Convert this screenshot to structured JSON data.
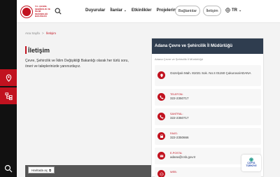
{
  "logo": {
    "name": "T.C. ÇEVRE, ŞEHİRCİLİK VE İKLİM DEĞİŞİKLİĞİ BAKANLIĞI"
  },
  "nav": {
    "items": [
      "Duyurular",
      "İlanlar",
      "Etkinlikler",
      "Projelerimiz"
    ]
  },
  "header_buttons": {
    "baglantilar": "Bağlantılar",
    "iletisim": "İletişim"
  },
  "lang": {
    "code": "TR"
  },
  "breadcrumb": {
    "home": "Ana Sayfa",
    "sep": ">",
    "current": "İletişim"
  },
  "page": {
    "title": "İletişim",
    "intro": "Çevre, Şehircilik ve İklim Değişikliği Bakanlığı olarak her türlü soru, öneri ve taleplerinizde yanınızdayız."
  },
  "map": {
    "chip": "Haritada aç"
  },
  "panel": {
    "title": "Adana Çevre ve Şehircilik İl Müdürlüğü",
    "subtitle": "Adana Çevre ve Şehircilik İl Müdürlüğü",
    "address": "Güzelyalı Mah. 81021 Sok. No:4 01150 Çukurova/ADANA",
    "phone_label": "TELEFON:",
    "phone": "322-2350717",
    "switchboard_label": "SANTRAL:",
    "switchboard": "322-2350717",
    "fax_label": "FAKS:",
    "fax": "322-2350666",
    "email_label": "E-POSTA:",
    "email": "adana@csb.gov.tr",
    "web_label": "WEB:"
  },
  "badge": {
    "line1": "COP31",
    "line2": "TÜRKİYE"
  },
  "colors": {
    "accent": "#c1121f",
    "panel_header": "#2f3d4f",
    "rail": "#111111"
  }
}
